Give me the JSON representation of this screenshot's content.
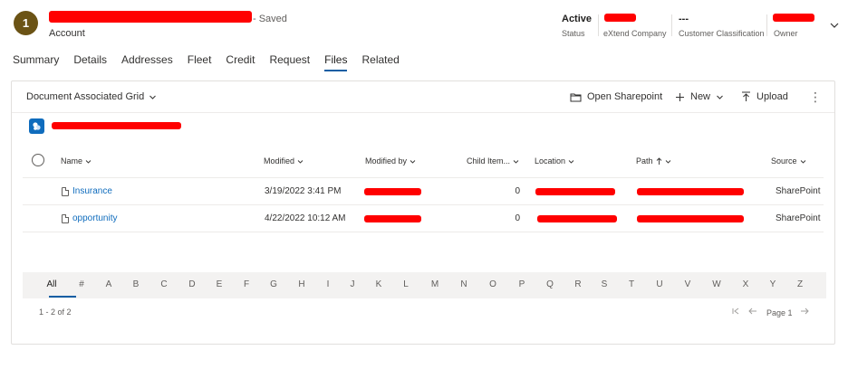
{
  "header": {
    "avatar_initial": "1",
    "saved_status": "- Saved",
    "entity_type": "Account",
    "fields": [
      {
        "value": "Active",
        "label": "Status"
      },
      {
        "value": "",
        "label": "eXtend Company"
      },
      {
        "value": "---",
        "label": "Customer Classification"
      },
      {
        "value": "",
        "label": "Owner"
      }
    ]
  },
  "tabs": [
    "Summary",
    "Details",
    "Addresses",
    "Fleet",
    "Credit",
    "Request",
    "Files",
    "Related"
  ],
  "active_tab": "Files",
  "grid": {
    "view_name": "Document Associated Grid",
    "commands": {
      "open_sharepoint": "Open Sharepoint",
      "new": "New",
      "upload": "Upload"
    },
    "columns": [
      "Name",
      "Modified",
      "Modified by",
      "Child Item...",
      "Location",
      "Path",
      "Source"
    ],
    "rows": [
      {
        "name": "Insurance",
        "modified": "3/19/2022 3:41 PM",
        "child_items": "0",
        "source": "SharePoint"
      },
      {
        "name": "opportunity",
        "modified": "4/22/2022 10:12 AM",
        "child_items": "0",
        "source": "SharePoint"
      }
    ],
    "jump_letters": [
      "All",
      "#",
      "A",
      "B",
      "C",
      "D",
      "E",
      "F",
      "G",
      "H",
      "I",
      "J",
      "K",
      "L",
      "M",
      "N",
      "O",
      "P",
      "Q",
      "R",
      "S",
      "T",
      "U",
      "V",
      "W",
      "X",
      "Y",
      "Z"
    ],
    "active_letter": "All",
    "page_info": "1 - 2 of 2",
    "page_label": "Page 1"
  },
  "colors": {
    "accent": "#115ea3",
    "link": "#0f6cbd",
    "avatar": "#6b5315",
    "redaction": "#ff0000"
  },
  "icons": [
    "chevron-down-icon",
    "folder-icon",
    "plus-icon",
    "upload-icon",
    "more-icon",
    "sharepoint-icon",
    "file-icon",
    "sort-up-icon",
    "first-page-icon",
    "prev-page-icon",
    "next-page-icon"
  ]
}
